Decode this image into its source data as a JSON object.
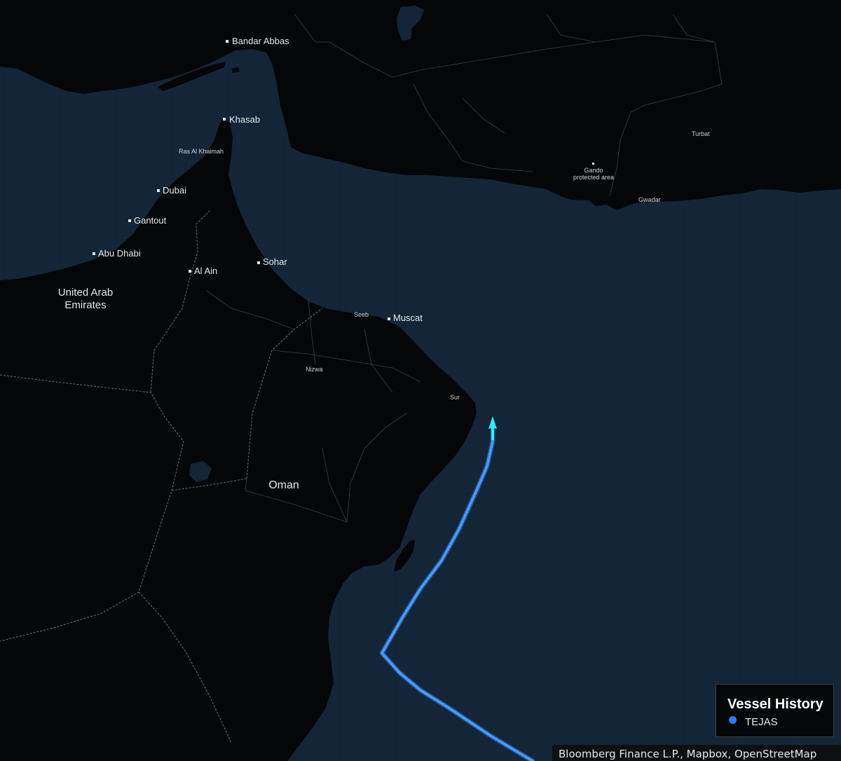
{
  "map": {
    "colors": {
      "water": "#132537",
      "land": "#050608",
      "border": "#6a6e74",
      "track": "#3b8cf5",
      "vessel_head": "#35e8f2"
    },
    "cities": [
      {
        "id": "bandar-abbas",
        "label": "Bandar Abbas"
      },
      {
        "id": "khasab",
        "label": "Khasab"
      },
      {
        "id": "ras-al-khaimah",
        "label": "Ras Al Khaimah"
      },
      {
        "id": "dubai",
        "label": "Dubai"
      },
      {
        "id": "gantout",
        "label": "Gantout"
      },
      {
        "id": "abu-dhabi",
        "label": "Abu Dhabi"
      },
      {
        "id": "al-ain",
        "label": "Al Ain"
      },
      {
        "id": "sohar",
        "label": "Sohar"
      },
      {
        "id": "seeb",
        "label": "Seeb"
      },
      {
        "id": "muscat",
        "label": "Muscat"
      },
      {
        "id": "nizwa",
        "label": "Nizwa"
      },
      {
        "id": "sur",
        "label": "Sur"
      },
      {
        "id": "turbat",
        "label": "Turbat"
      },
      {
        "id": "gando",
        "label": "Gando\nprotected area"
      },
      {
        "id": "gwadar",
        "label": "Gwadar"
      }
    ],
    "countries": [
      {
        "id": "uae",
        "label": "United Arab\nEmirates"
      },
      {
        "id": "oman",
        "label": "Oman"
      }
    ]
  },
  "legend": {
    "title": "Vessel History",
    "items": [
      {
        "label": "TEJAS",
        "color": "#2a7df0",
        "icon": "circle-icon"
      }
    ]
  },
  "attribution": "Bloomberg Finance L.P., Mapbox, OpenStreetMap"
}
